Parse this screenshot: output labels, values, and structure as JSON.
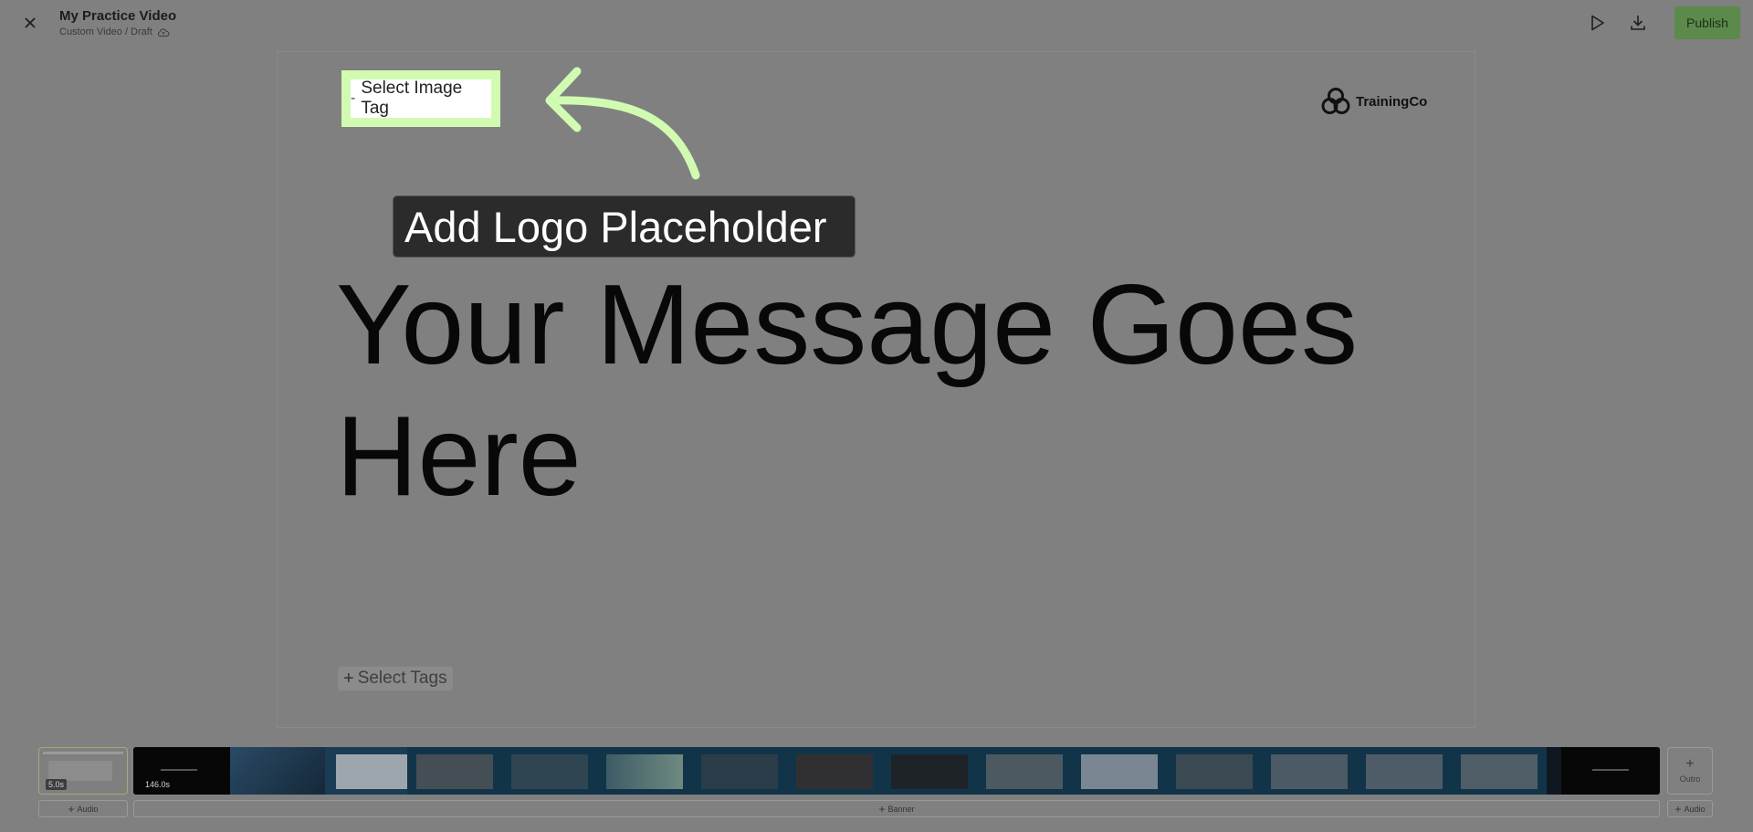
{
  "header": {
    "title": "My Practice Video",
    "subtitle": "Custom Video / Draft",
    "publish_label": "Publish"
  },
  "canvas": {
    "image_tag_label": "Select Image Tag",
    "tooltip_text": "Add Logo Placeholder",
    "message_line1": "Your Message Goes",
    "message_line2": "Here",
    "logo_text": "TrainingCo",
    "select_tags_label": "Select Tags",
    "highlight_color": "#d2fbb2"
  },
  "timeline": {
    "intro_duration": "5.0s",
    "main_duration": "146.0s",
    "outro_label": "Outro",
    "audio_left_label": "Audio",
    "banner_label": "Banner",
    "audio_right_label": "Audio"
  },
  "icons": {
    "close": "close-icon",
    "cloud": "cloud-sync-icon",
    "play": "play-icon",
    "download": "download-icon",
    "arrow": "curved-arrow-icon",
    "logo": "trainingco-logo-icon"
  },
  "colors": {
    "overlay_gray": "#808080",
    "publish_green": "#5b8a4a",
    "strip_dark": "#0f1820"
  }
}
